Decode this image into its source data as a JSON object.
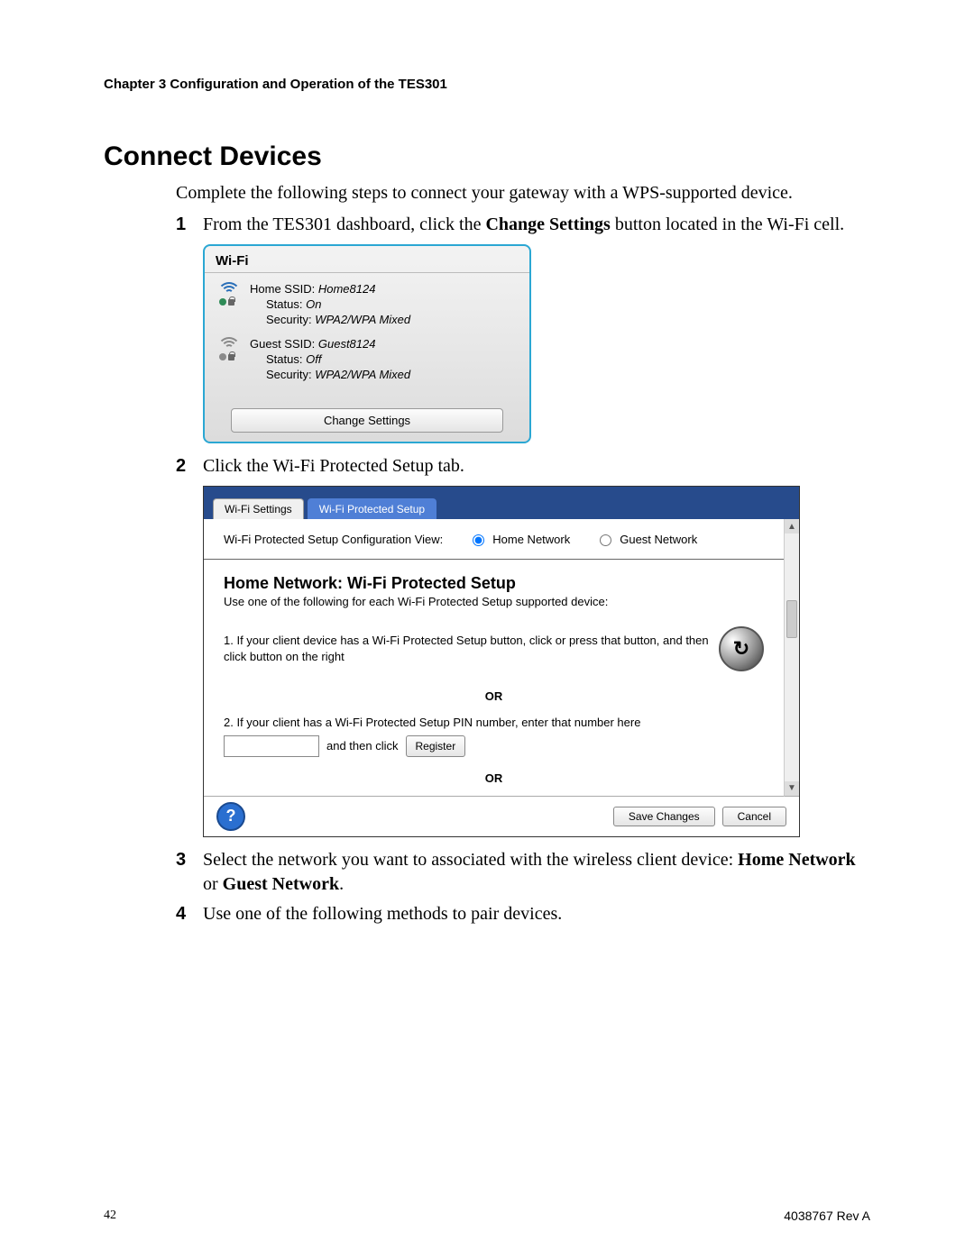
{
  "header": {
    "chapter": "Chapter 3    Configuration and Operation of the TES301"
  },
  "section_title": "Connect Devices",
  "intro": "Complete the following steps to connect your gateway with a WPS-supported device.",
  "steps": {
    "s1": {
      "num": "1",
      "pre": "From the TES301 dashboard, click the ",
      "bold": "Change Settings",
      "post": " button located in the Wi-Fi cell."
    },
    "s2": {
      "num": "2",
      "text": "Click the Wi-Fi Protected Setup tab."
    },
    "s3": {
      "num": "3",
      "pre": "Select the network you want to associated with the wireless client device: ",
      "bold1": "Home Network",
      "mid": " or ",
      "bold2": "Guest Network",
      "post": "."
    },
    "s4": {
      "num": "4",
      "text": "Use one of the following methods to pair devices."
    }
  },
  "wifi_card": {
    "title": "Wi-Fi",
    "home": {
      "ssid_label": "Home SSID: ",
      "ssid": "Home8124",
      "status_label": "Status: ",
      "status": "On",
      "security_label": "Security: ",
      "security": "WPA2/WPA Mixed"
    },
    "guest": {
      "ssid_label": "Guest SSID: ",
      "ssid": "Guest8124",
      "status_label": "Status: ",
      "status": "Off",
      "security_label": "Security: ",
      "security": "WPA2/WPA Mixed"
    },
    "change_btn": "Change Settings"
  },
  "wps": {
    "tabs": {
      "t1": "Wi-Fi Settings",
      "t2": "Wi-Fi Protected Setup"
    },
    "config_label": "Wi-Fi Protected Setup Configuration View:",
    "radios": {
      "home": "Home Network",
      "guest": "Guest Network"
    },
    "heading": "Home Network: Wi-Fi Protected Setup",
    "subheading": "Use one of the following for each Wi-Fi Protected Setup supported device:",
    "step1": "1. If your client device has a Wi-Fi Protected Setup button, click or press that button, and then click button on the right",
    "or": "OR",
    "step2": "2. If your client has a Wi-Fi Protected Setup PIN number, enter that number here",
    "and_then": "and then click",
    "register": "Register",
    "save": "Save Changes",
    "cancel": "Cancel"
  },
  "footer": {
    "page": "42",
    "rev": "4038767 Rev A"
  }
}
